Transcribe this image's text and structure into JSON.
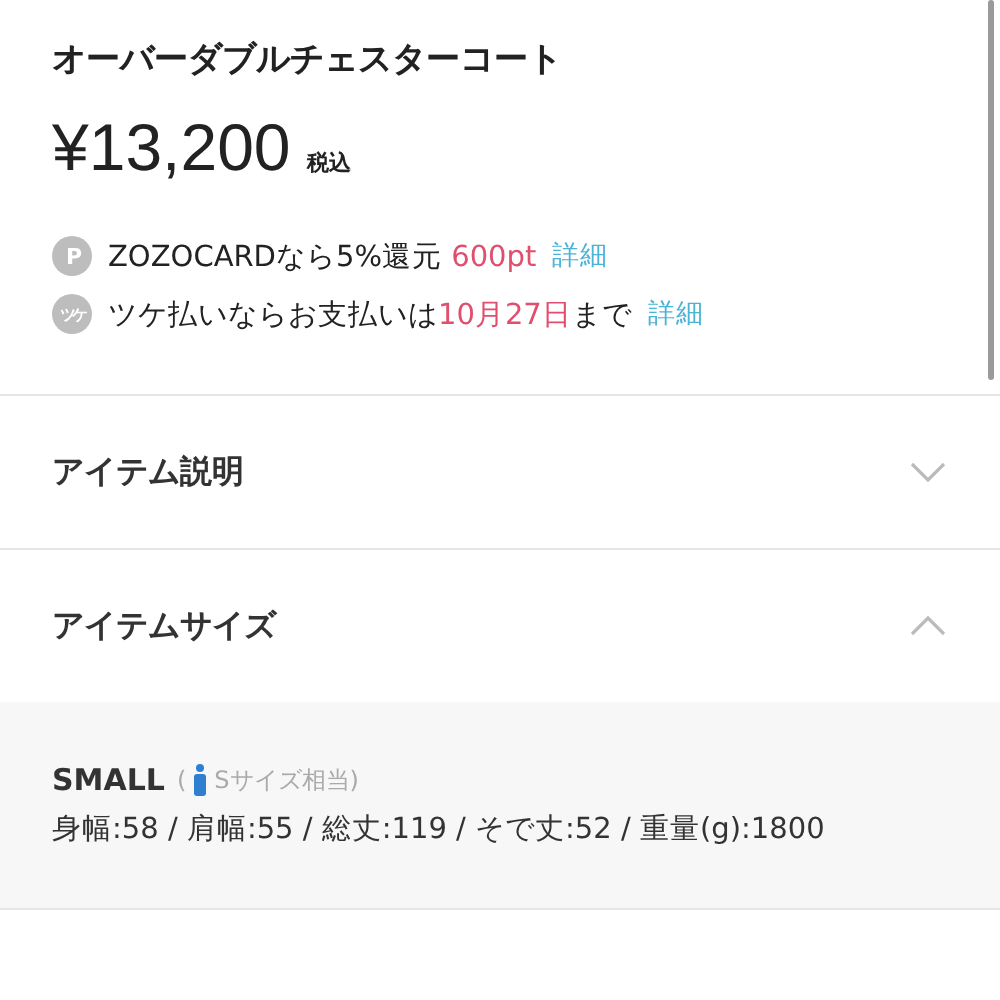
{
  "product": {
    "title": "オーバーダブルチェスターコート",
    "price": "¥13,200",
    "tax_note": "税込"
  },
  "benefits": [
    {
      "icon": "P",
      "parts": [
        {
          "text": "ZOZOCARDなら5%還元 ",
          "emphasis": false
        },
        {
          "text": "600pt",
          "emphasis": true
        }
      ],
      "link": "詳細"
    },
    {
      "icon": "ツケ",
      "parts": [
        {
          "text": "ツケ払いならお支払いは",
          "emphasis": false
        },
        {
          "text": "10月27日",
          "emphasis": true
        },
        {
          "text": "まで",
          "emphasis": false
        }
      ],
      "link": "詳細"
    }
  ],
  "sections": [
    {
      "title": "アイテム説明",
      "expanded": false
    },
    {
      "title": "アイテムサイズ",
      "expanded": true,
      "sizes": [
        {
          "name": "SMALL",
          "note_open": "(",
          "note": "Sサイズ相当)",
          "measurements": "身幅:58 / 肩幅:55 / 総丈:119 / そで丈:52 / 重量(g):1800"
        }
      ]
    }
  ]
}
